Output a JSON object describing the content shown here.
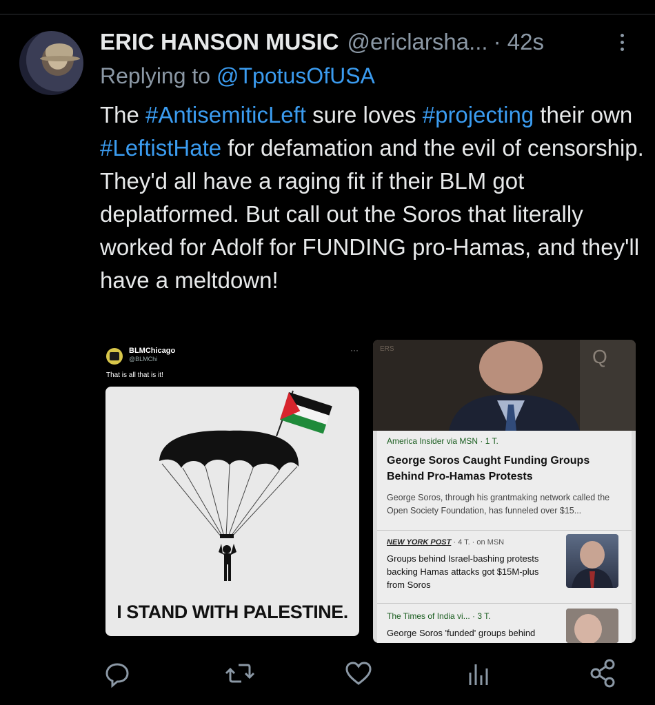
{
  "post": {
    "author_name": "ERIC HANSON MUSIC",
    "author_handle": "@ericlarsha...",
    "time": "· 42s",
    "replying_prefix": "Replying to ",
    "replying_to": "@TpotusOfUSA",
    "text_parts": [
      {
        "t": "The ",
        "tag": false
      },
      {
        "t": "#AntisemiticLeft",
        "tag": true
      },
      {
        "t": " sure loves ",
        "tag": false
      },
      {
        "t": "#projecting",
        "tag": true
      },
      {
        "t": " their own ",
        "tag": false
      },
      {
        "t": "#LeftistHate",
        "tag": true
      },
      {
        "t": " for defamation and the evil of censorship.  They'd all have a raging fit if their BLM got deplatformed.  But call out the Soros that literally worked for Adolf for FUNDING pro-Hamas, and they'll have a meltdown!",
        "tag": false
      }
    ]
  },
  "media_left": {
    "account_name": "BLMChicago",
    "account_handle": "@BLMChi",
    "text": "That is all that is it!",
    "caption": "I STAND WITH PALESTINE."
  },
  "media_right": {
    "photo_label": "ERS",
    "results": [
      {
        "source": "America Insider via MSN · 1 T.",
        "title": "George Soros Caught Funding Groups Behind Pro-Hamas Protests",
        "snippet": "George Soros, through his grantmaking network called the Open Society Foundation, has funneled over $15..."
      },
      {
        "source_logo": "NEW YORK POST",
        "source": " · 4 T. · on MSN",
        "title": "Groups behind Israel-bashing protests backing Hamas attacks got $15M-plus from Soros"
      },
      {
        "source": "The Times of India vi... · 3 T.",
        "title": "George Soros 'funded' groups behind"
      }
    ]
  },
  "actions": {
    "icons": [
      "reply-icon",
      "repost-icon",
      "like-icon",
      "views-icon",
      "share-icon"
    ]
  },
  "colors": {
    "background": "#000000",
    "text": "#e7e9ea",
    "muted": "#8b98a5",
    "link": "#3b9cf0"
  }
}
